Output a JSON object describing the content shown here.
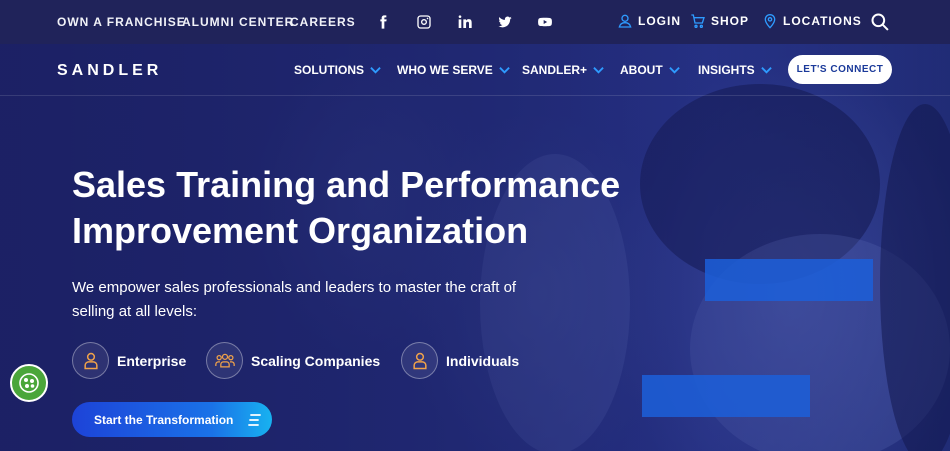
{
  "topbar": {
    "links": [
      "OWN A FRANCHISE",
      "ALUMNI CENTER",
      "CAREERS"
    ],
    "social_icons": [
      "facebook-icon",
      "instagram-icon",
      "linkedin-icon",
      "twitter-icon",
      "youtube-icon"
    ],
    "login_label": "LOGIN",
    "shop_label": "SHOP",
    "locations_label": "LOCATIONS"
  },
  "nav": {
    "logo": "SANDLER",
    "items": [
      "SOLUTIONS",
      "WHO WE SERVE",
      "SANDLER+",
      "ABOUT",
      "INSIGHTS"
    ],
    "connect_label": "LET'S CONNECT"
  },
  "hero": {
    "headline": "Sales Training and Performance Improvement Organization",
    "subtext": "We empower sales professionals and leaders to master the craft of selling at all levels:",
    "audiences": [
      "Enterprise",
      "Scaling Companies",
      "Individuals"
    ],
    "cta_label": "Start the Transformation"
  },
  "colors": {
    "topbar_bg": "#20235a",
    "accent_blue": "#1c5fd9",
    "icon_orange": "#f0a24a",
    "cookie_green": "#4aa63a"
  }
}
